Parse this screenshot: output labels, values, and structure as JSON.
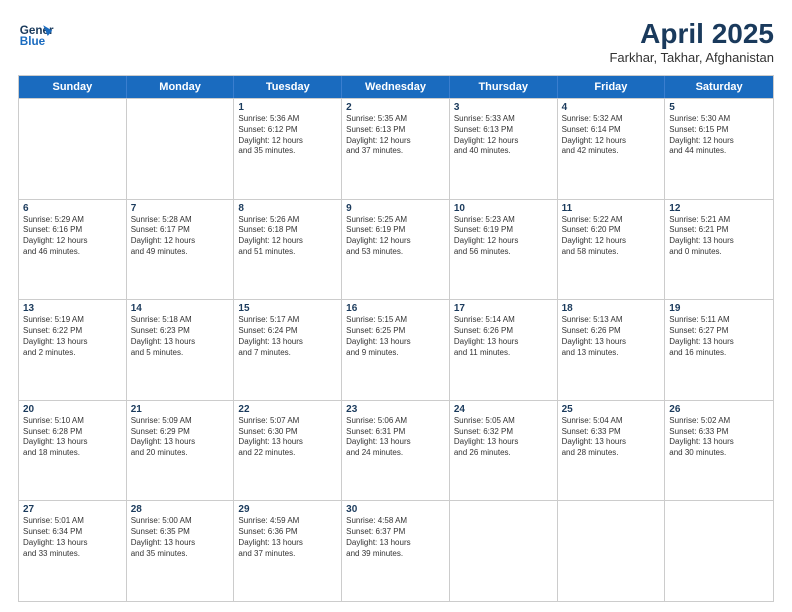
{
  "header": {
    "logo_line1": "General",
    "logo_line2": "Blue",
    "title": "April 2025",
    "subtitle": "Farkhar, Takhar, Afghanistan"
  },
  "weekdays": [
    "Sunday",
    "Monday",
    "Tuesday",
    "Wednesday",
    "Thursday",
    "Friday",
    "Saturday"
  ],
  "weeks": [
    [
      {
        "day": "",
        "info": ""
      },
      {
        "day": "",
        "info": ""
      },
      {
        "day": "1",
        "info": "Sunrise: 5:36 AM\nSunset: 6:12 PM\nDaylight: 12 hours\nand 35 minutes."
      },
      {
        "day": "2",
        "info": "Sunrise: 5:35 AM\nSunset: 6:13 PM\nDaylight: 12 hours\nand 37 minutes."
      },
      {
        "day": "3",
        "info": "Sunrise: 5:33 AM\nSunset: 6:13 PM\nDaylight: 12 hours\nand 40 minutes."
      },
      {
        "day": "4",
        "info": "Sunrise: 5:32 AM\nSunset: 6:14 PM\nDaylight: 12 hours\nand 42 minutes."
      },
      {
        "day": "5",
        "info": "Sunrise: 5:30 AM\nSunset: 6:15 PM\nDaylight: 12 hours\nand 44 minutes."
      }
    ],
    [
      {
        "day": "6",
        "info": "Sunrise: 5:29 AM\nSunset: 6:16 PM\nDaylight: 12 hours\nand 46 minutes."
      },
      {
        "day": "7",
        "info": "Sunrise: 5:28 AM\nSunset: 6:17 PM\nDaylight: 12 hours\nand 49 minutes."
      },
      {
        "day": "8",
        "info": "Sunrise: 5:26 AM\nSunset: 6:18 PM\nDaylight: 12 hours\nand 51 minutes."
      },
      {
        "day": "9",
        "info": "Sunrise: 5:25 AM\nSunset: 6:19 PM\nDaylight: 12 hours\nand 53 minutes."
      },
      {
        "day": "10",
        "info": "Sunrise: 5:23 AM\nSunset: 6:19 PM\nDaylight: 12 hours\nand 56 minutes."
      },
      {
        "day": "11",
        "info": "Sunrise: 5:22 AM\nSunset: 6:20 PM\nDaylight: 12 hours\nand 58 minutes."
      },
      {
        "day": "12",
        "info": "Sunrise: 5:21 AM\nSunset: 6:21 PM\nDaylight: 13 hours\nand 0 minutes."
      }
    ],
    [
      {
        "day": "13",
        "info": "Sunrise: 5:19 AM\nSunset: 6:22 PM\nDaylight: 13 hours\nand 2 minutes."
      },
      {
        "day": "14",
        "info": "Sunrise: 5:18 AM\nSunset: 6:23 PM\nDaylight: 13 hours\nand 5 minutes."
      },
      {
        "day": "15",
        "info": "Sunrise: 5:17 AM\nSunset: 6:24 PM\nDaylight: 13 hours\nand 7 minutes."
      },
      {
        "day": "16",
        "info": "Sunrise: 5:15 AM\nSunset: 6:25 PM\nDaylight: 13 hours\nand 9 minutes."
      },
      {
        "day": "17",
        "info": "Sunrise: 5:14 AM\nSunset: 6:26 PM\nDaylight: 13 hours\nand 11 minutes."
      },
      {
        "day": "18",
        "info": "Sunrise: 5:13 AM\nSunset: 6:26 PM\nDaylight: 13 hours\nand 13 minutes."
      },
      {
        "day": "19",
        "info": "Sunrise: 5:11 AM\nSunset: 6:27 PM\nDaylight: 13 hours\nand 16 minutes."
      }
    ],
    [
      {
        "day": "20",
        "info": "Sunrise: 5:10 AM\nSunset: 6:28 PM\nDaylight: 13 hours\nand 18 minutes."
      },
      {
        "day": "21",
        "info": "Sunrise: 5:09 AM\nSunset: 6:29 PM\nDaylight: 13 hours\nand 20 minutes."
      },
      {
        "day": "22",
        "info": "Sunrise: 5:07 AM\nSunset: 6:30 PM\nDaylight: 13 hours\nand 22 minutes."
      },
      {
        "day": "23",
        "info": "Sunrise: 5:06 AM\nSunset: 6:31 PM\nDaylight: 13 hours\nand 24 minutes."
      },
      {
        "day": "24",
        "info": "Sunrise: 5:05 AM\nSunset: 6:32 PM\nDaylight: 13 hours\nand 26 minutes."
      },
      {
        "day": "25",
        "info": "Sunrise: 5:04 AM\nSunset: 6:33 PM\nDaylight: 13 hours\nand 28 minutes."
      },
      {
        "day": "26",
        "info": "Sunrise: 5:02 AM\nSunset: 6:33 PM\nDaylight: 13 hours\nand 30 minutes."
      }
    ],
    [
      {
        "day": "27",
        "info": "Sunrise: 5:01 AM\nSunset: 6:34 PM\nDaylight: 13 hours\nand 33 minutes."
      },
      {
        "day": "28",
        "info": "Sunrise: 5:00 AM\nSunset: 6:35 PM\nDaylight: 13 hours\nand 35 minutes."
      },
      {
        "day": "29",
        "info": "Sunrise: 4:59 AM\nSunset: 6:36 PM\nDaylight: 13 hours\nand 37 minutes."
      },
      {
        "day": "30",
        "info": "Sunrise: 4:58 AM\nSunset: 6:37 PM\nDaylight: 13 hours\nand 39 minutes."
      },
      {
        "day": "",
        "info": ""
      },
      {
        "day": "",
        "info": ""
      },
      {
        "day": "",
        "info": ""
      }
    ]
  ]
}
